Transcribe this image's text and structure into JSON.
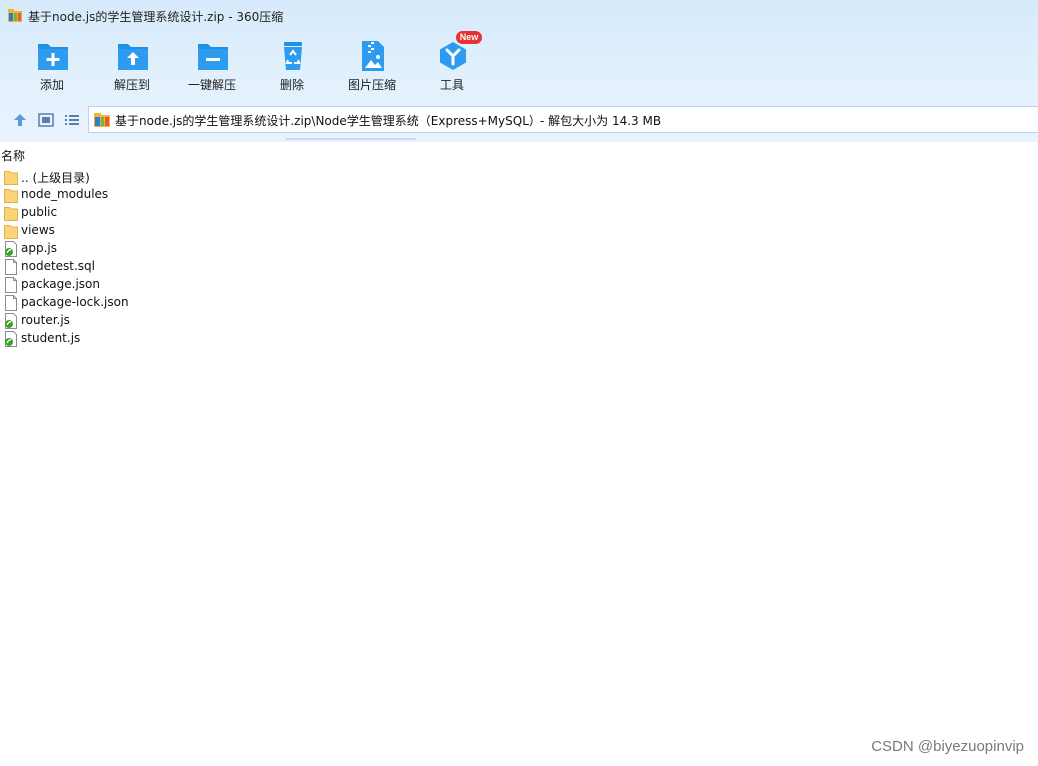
{
  "window": {
    "title": "基于node.js的学生管理系统设计.zip - 360压缩"
  },
  "toolbar": {
    "items": [
      {
        "label": "添加",
        "icon": "add-folder-icon"
      },
      {
        "label": "解压到",
        "icon": "extract-to-icon"
      },
      {
        "label": "一键解压",
        "icon": "one-click-extract-icon"
      },
      {
        "label": "删除",
        "icon": "recycle-bin-icon"
      },
      {
        "label": "图片压缩",
        "icon": "image-compress-icon"
      },
      {
        "label": "工具",
        "icon": "tools-icon",
        "badge": "New"
      }
    ]
  },
  "nav": {
    "path": "基于node.js的学生管理系统设计.zip\\Node学生管理系统（Express+MySQL）",
    "unpacked_size": "- 解包大小为 14.3 MB"
  },
  "file_list": {
    "column_name": "名称",
    "items": [
      {
        "name": ".. (上级目录)",
        "type": "folder"
      },
      {
        "name": "node_modules",
        "type": "folder"
      },
      {
        "name": "public",
        "type": "folder"
      },
      {
        "name": "views",
        "type": "folder"
      },
      {
        "name": "app.js",
        "type": "js"
      },
      {
        "name": "nodetest.sql",
        "type": "file"
      },
      {
        "name": "package.json",
        "type": "file"
      },
      {
        "name": "package-lock.json",
        "type": "file"
      },
      {
        "name": "router.js",
        "type": "js"
      },
      {
        "name": "student.js",
        "type": "js"
      }
    ]
  },
  "watermark": "CSDN @biyezuopinvip",
  "colors": {
    "accent": "#1e90e6",
    "chrome_bg": "#dcecfb",
    "badge": "#e8322d"
  }
}
